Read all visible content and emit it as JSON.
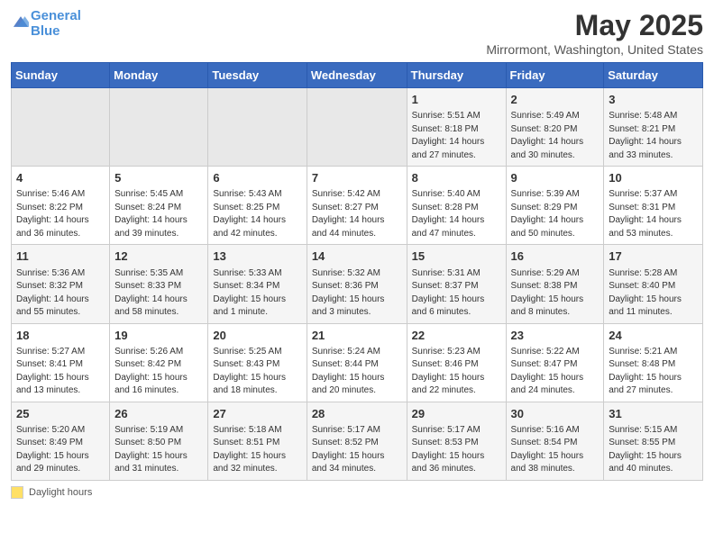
{
  "logo": {
    "line1": "General",
    "line2": "Blue"
  },
  "title": "May 2025",
  "location": "Mirrormont, Washington, United States",
  "days_of_week": [
    "Sunday",
    "Monday",
    "Tuesday",
    "Wednesday",
    "Thursday",
    "Friday",
    "Saturday"
  ],
  "weeks": [
    [
      {
        "num": "",
        "detail": ""
      },
      {
        "num": "",
        "detail": ""
      },
      {
        "num": "",
        "detail": ""
      },
      {
        "num": "",
        "detail": ""
      },
      {
        "num": "1",
        "detail": "Sunrise: 5:51 AM\nSunset: 8:18 PM\nDaylight: 14 hours\nand 27 minutes."
      },
      {
        "num": "2",
        "detail": "Sunrise: 5:49 AM\nSunset: 8:20 PM\nDaylight: 14 hours\nand 30 minutes."
      },
      {
        "num": "3",
        "detail": "Sunrise: 5:48 AM\nSunset: 8:21 PM\nDaylight: 14 hours\nand 33 minutes."
      }
    ],
    [
      {
        "num": "4",
        "detail": "Sunrise: 5:46 AM\nSunset: 8:22 PM\nDaylight: 14 hours\nand 36 minutes."
      },
      {
        "num": "5",
        "detail": "Sunrise: 5:45 AM\nSunset: 8:24 PM\nDaylight: 14 hours\nand 39 minutes."
      },
      {
        "num": "6",
        "detail": "Sunrise: 5:43 AM\nSunset: 8:25 PM\nDaylight: 14 hours\nand 42 minutes."
      },
      {
        "num": "7",
        "detail": "Sunrise: 5:42 AM\nSunset: 8:27 PM\nDaylight: 14 hours\nand 44 minutes."
      },
      {
        "num": "8",
        "detail": "Sunrise: 5:40 AM\nSunset: 8:28 PM\nDaylight: 14 hours\nand 47 minutes."
      },
      {
        "num": "9",
        "detail": "Sunrise: 5:39 AM\nSunset: 8:29 PM\nDaylight: 14 hours\nand 50 minutes."
      },
      {
        "num": "10",
        "detail": "Sunrise: 5:37 AM\nSunset: 8:31 PM\nDaylight: 14 hours\nand 53 minutes."
      }
    ],
    [
      {
        "num": "11",
        "detail": "Sunrise: 5:36 AM\nSunset: 8:32 PM\nDaylight: 14 hours\nand 55 minutes."
      },
      {
        "num": "12",
        "detail": "Sunrise: 5:35 AM\nSunset: 8:33 PM\nDaylight: 14 hours\nand 58 minutes."
      },
      {
        "num": "13",
        "detail": "Sunrise: 5:33 AM\nSunset: 8:34 PM\nDaylight: 15 hours\nand 1 minute."
      },
      {
        "num": "14",
        "detail": "Sunrise: 5:32 AM\nSunset: 8:36 PM\nDaylight: 15 hours\nand 3 minutes."
      },
      {
        "num": "15",
        "detail": "Sunrise: 5:31 AM\nSunset: 8:37 PM\nDaylight: 15 hours\nand 6 minutes."
      },
      {
        "num": "16",
        "detail": "Sunrise: 5:29 AM\nSunset: 8:38 PM\nDaylight: 15 hours\nand 8 minutes."
      },
      {
        "num": "17",
        "detail": "Sunrise: 5:28 AM\nSunset: 8:40 PM\nDaylight: 15 hours\nand 11 minutes."
      }
    ],
    [
      {
        "num": "18",
        "detail": "Sunrise: 5:27 AM\nSunset: 8:41 PM\nDaylight: 15 hours\nand 13 minutes."
      },
      {
        "num": "19",
        "detail": "Sunrise: 5:26 AM\nSunset: 8:42 PM\nDaylight: 15 hours\nand 16 minutes."
      },
      {
        "num": "20",
        "detail": "Sunrise: 5:25 AM\nSunset: 8:43 PM\nDaylight: 15 hours\nand 18 minutes."
      },
      {
        "num": "21",
        "detail": "Sunrise: 5:24 AM\nSunset: 8:44 PM\nDaylight: 15 hours\nand 20 minutes."
      },
      {
        "num": "22",
        "detail": "Sunrise: 5:23 AM\nSunset: 8:46 PM\nDaylight: 15 hours\nand 22 minutes."
      },
      {
        "num": "23",
        "detail": "Sunrise: 5:22 AM\nSunset: 8:47 PM\nDaylight: 15 hours\nand 24 minutes."
      },
      {
        "num": "24",
        "detail": "Sunrise: 5:21 AM\nSunset: 8:48 PM\nDaylight: 15 hours\nand 27 minutes."
      }
    ],
    [
      {
        "num": "25",
        "detail": "Sunrise: 5:20 AM\nSunset: 8:49 PM\nDaylight: 15 hours\nand 29 minutes."
      },
      {
        "num": "26",
        "detail": "Sunrise: 5:19 AM\nSunset: 8:50 PM\nDaylight: 15 hours\nand 31 minutes."
      },
      {
        "num": "27",
        "detail": "Sunrise: 5:18 AM\nSunset: 8:51 PM\nDaylight: 15 hours\nand 32 minutes."
      },
      {
        "num": "28",
        "detail": "Sunrise: 5:17 AM\nSunset: 8:52 PM\nDaylight: 15 hours\nand 34 minutes."
      },
      {
        "num": "29",
        "detail": "Sunrise: 5:17 AM\nSunset: 8:53 PM\nDaylight: 15 hours\nand 36 minutes."
      },
      {
        "num": "30",
        "detail": "Sunrise: 5:16 AM\nSunset: 8:54 PM\nDaylight: 15 hours\nand 38 minutes."
      },
      {
        "num": "31",
        "detail": "Sunrise: 5:15 AM\nSunset: 8:55 PM\nDaylight: 15 hours\nand 40 minutes."
      }
    ]
  ],
  "footer": {
    "daylight_label": "Daylight hours"
  }
}
